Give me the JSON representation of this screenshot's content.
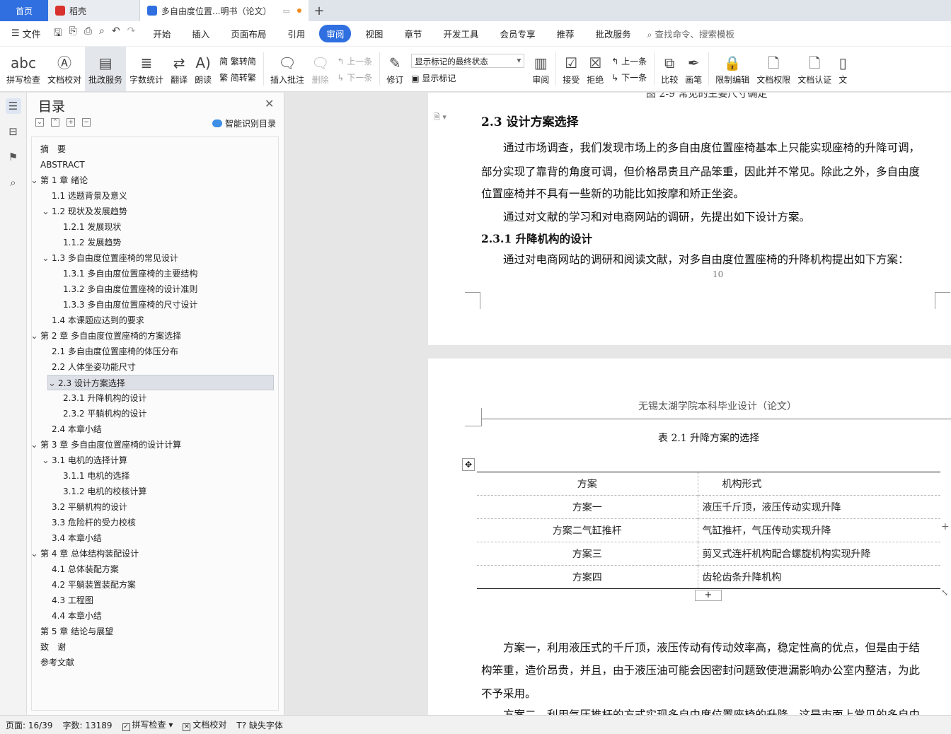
{
  "titlebar": {
    "home_tab": "首页",
    "tab2": "稻壳",
    "doc_tab": "多自由度位置...明书（论文）",
    "add_tab": "+"
  },
  "menubar": {
    "file": "文件",
    "items": [
      "开始",
      "插入",
      "页面布局",
      "引用",
      "审阅",
      "视图",
      "章节",
      "开发工具",
      "会员专享",
      "推荐",
      "批改服务"
    ],
    "active": "审阅",
    "search": "查找命令、搜索模板"
  },
  "ribbon": {
    "spellcheck": "拼写检查",
    "doc_proof": "文档校对",
    "correct_service": "批改服务",
    "word_count": "字数统计",
    "translate": "翻译",
    "read_aloud": "朗读",
    "trad_simp": "繁转简",
    "simp_trad": "简转繁",
    "insert_comment": "插入批注",
    "delete": "删除",
    "prev": "上一条",
    "next": "下一条",
    "revise": "修订",
    "markup_select": "显示标记的最终状态",
    "show_markup": "显示标记",
    "review": "审阅",
    "accept": "接受",
    "reject": "拒绝",
    "prev2": "上一条",
    "next2": "下一条",
    "compare": "比较",
    "pen": "画笔",
    "restrict_edit": "限制编辑",
    "doc_permission": "文档权限",
    "doc_cert": "文档认证",
    "doc_cut": "文"
  },
  "toc": {
    "title": "目录",
    "smart": "智能识别目录",
    "items": [
      {
        "text": "摘　要",
        "level": 0,
        "chev": ""
      },
      {
        "text": "ABSTRACT",
        "level": 0,
        "chev": ""
      },
      {
        "text": "第 1 章  绪论",
        "level": 0,
        "chev": "v"
      },
      {
        "text": "1.1 选题背景及意义",
        "level": 1,
        "chev": ""
      },
      {
        "text": "1.2  现状及发展趋势",
        "level": 1,
        "chev": "v"
      },
      {
        "text": "1.2.1  发展现状",
        "level": 2,
        "chev": ""
      },
      {
        "text": "1.1.2  发展趋势",
        "level": 2,
        "chev": ""
      },
      {
        "text": "1.3 多自由度位置座椅的常见设计",
        "level": 1,
        "chev": "v"
      },
      {
        "text": "1.3.1  多自由度位置座椅的主要结构",
        "level": 2,
        "chev": ""
      },
      {
        "text": "1.3.2  多自由度位置座椅的设计准则",
        "level": 2,
        "chev": ""
      },
      {
        "text": "1.3.3  多自由度位置座椅的尺寸设计",
        "level": 2,
        "chev": ""
      },
      {
        "text": "1.4  本课题应达到的要求",
        "level": 1,
        "chev": ""
      },
      {
        "text": "第 2 章  多自由度位置座椅的方案选择",
        "level": 0,
        "chev": "v"
      },
      {
        "text": "2.1  多自由度位置座椅的体压分布",
        "level": 1,
        "chev": ""
      },
      {
        "text": "2.2 人体坐姿功能尺寸",
        "level": 1,
        "chev": ""
      },
      {
        "text": "2.3  设计方案选择",
        "level": 1,
        "chev": "v",
        "selected": true
      },
      {
        "text": "2.3.1  升降机构的设计",
        "level": 2,
        "chev": ""
      },
      {
        "text": "2.3.2  平躺机构的设计",
        "level": 2,
        "chev": ""
      },
      {
        "text": "2.4  本章小结",
        "level": 1,
        "chev": ""
      },
      {
        "text": "第 3 章  多自由度位置座椅的设计计算",
        "level": 0,
        "chev": "v"
      },
      {
        "text": "3.1 电机的选择计算",
        "level": 1,
        "chev": "v"
      },
      {
        "text": "3.1.1 电机的选择",
        "level": 2,
        "chev": ""
      },
      {
        "text": "3.1.2 电机的校核计算",
        "level": 2,
        "chev": ""
      },
      {
        "text": "3.2 平躺机构的设计",
        "level": 1,
        "chev": ""
      },
      {
        "text": "3.3 危险杆的受力校核",
        "level": 1,
        "chev": ""
      },
      {
        "text": "3.4 本章小结",
        "level": 1,
        "chev": ""
      },
      {
        "text": "第 4 章  总体结构装配设计",
        "level": 0,
        "chev": "v"
      },
      {
        "text": "4.1 总体装配方案",
        "level": 1,
        "chev": ""
      },
      {
        "text": "4.2 平躺装置装配方案",
        "level": 1,
        "chev": ""
      },
      {
        "text": "4.3  工程图",
        "level": 1,
        "chev": ""
      },
      {
        "text": "4.4 本章小结",
        "level": 1,
        "chev": ""
      },
      {
        "text": "第 5 章  结论与展望",
        "level": 0,
        "chev": ""
      },
      {
        "text": "致　谢",
        "level": 0,
        "chev": ""
      },
      {
        "text": "参考文献",
        "level": 0,
        "chev": ""
      }
    ]
  },
  "page1": {
    "cut_caption": "图 2-9  常见的主要尺寸确定",
    "h2": "2.3  设计方案选择",
    "p1_l1": "通过市场调查，我们发现市场上的多自由度位置座椅基本上只能实现座椅的升降可调，",
    "p1_l2": "部分实现了靠背的角度可调，但价格昂贵且产品笨重，因此并不常见。除此之外，多自由度",
    "p1_l3": "位置座椅并不具有一些新的功能比如按摩和矫正坐姿。",
    "p2": "通过对文献的学习和对电商网站的调研，先提出如下设计方案。",
    "h3": "2.3.1  升降机构的设计",
    "p3": "通过对电商网站的调研和阅读文献，对多自由度位置座椅的升降机构提出如下方案：",
    "page_number": "10"
  },
  "page2": {
    "header": "无锡太湖学院本科毕业设计（论文）",
    "table_caption": "表 2.1  升降方案的选择",
    "table": {
      "headers": [
        "方案",
        "机构形式"
      ],
      "rows": [
        [
          "方案一",
          "液压千斤顶，液压传动实现升降"
        ],
        [
          "方案二气缸推杆",
          "气缸推杆，气压传动实现升降"
        ],
        [
          "方案三",
          "剪叉式连杆机构配合螺旋机构实现升降"
        ],
        [
          "方案四",
          "齿轮齿条升降机构"
        ]
      ]
    },
    "p1_l1": "方案一，利用液压式的千斤顶，液压传动有传动效率高，稳定性高的优点，但是由于结",
    "p1_l2": "构笨重，造价昂贵，并且，由于液压油可能会因密封问题致使泄漏影响办公室内整洁，为此",
    "p1_l3": "不予采用。",
    "p2_cut": "方案二，利用气压推杆的方式实现多自由度位置座椅的升降，这是市面上常见的多自由"
  },
  "statusbar": {
    "page": "页面: 16/39",
    "words": "字数: 13189",
    "spell": "拼写检查",
    "proof": "文档校对",
    "missing_font": "缺失字体"
  }
}
